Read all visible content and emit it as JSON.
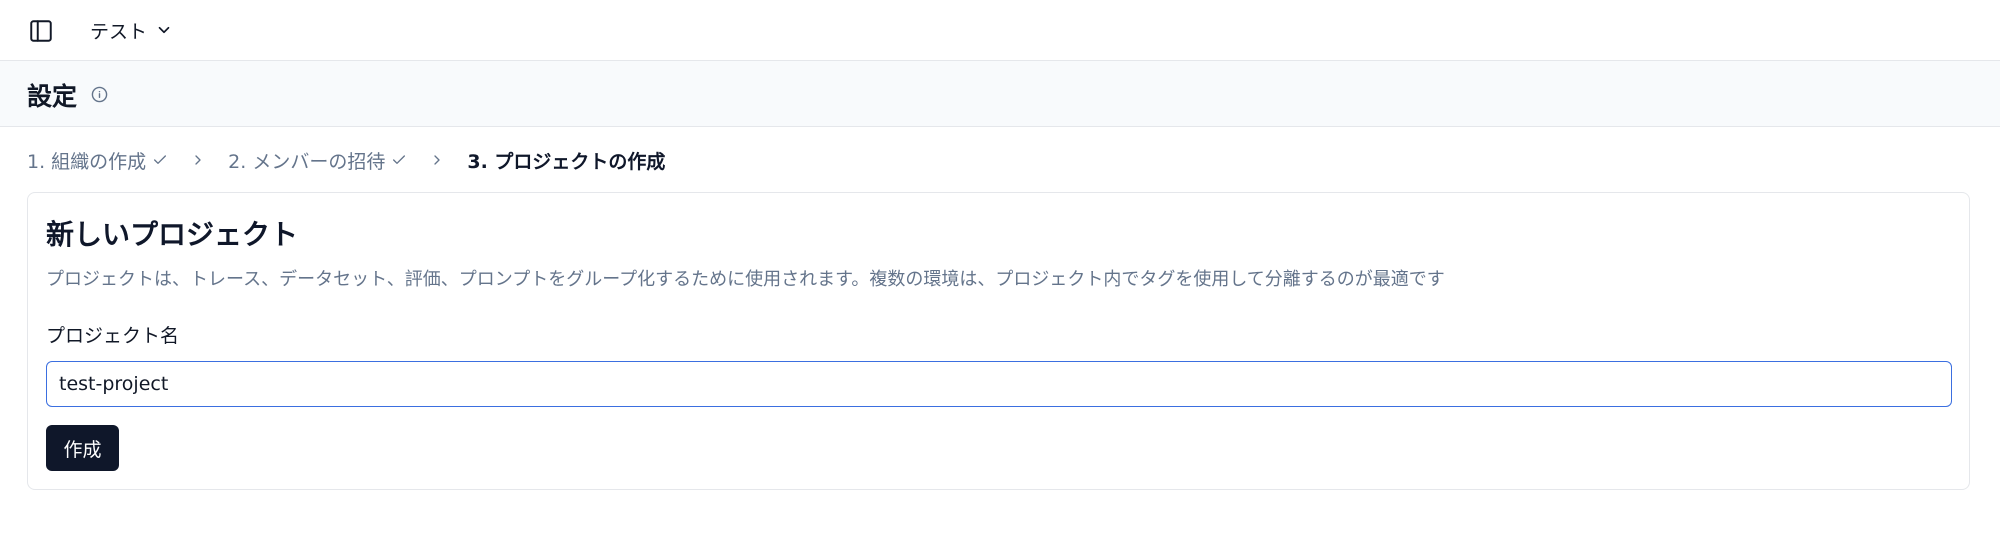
{
  "topbar": {
    "project_name": "テスト"
  },
  "header": {
    "title": "設定"
  },
  "stepper": {
    "steps": [
      {
        "label": "1. 組織の作成",
        "status": "done"
      },
      {
        "label": "2. メンバーの招待",
        "status": "done"
      },
      {
        "label": "3. プロジェクトの作成",
        "status": "active"
      }
    ]
  },
  "card": {
    "title": "新しいプロジェクト",
    "description": "プロジェクトは、トレース、データセット、評価、プロンプトをグループ化するために使用されます。複数の環境は、プロジェクト内でタグを使用して分離するのが最適です",
    "field_label": "プロジェクト名",
    "input_value": "test-project",
    "create_label": "作成"
  },
  "colors": {
    "accent": "#3b6fe0",
    "button_bg": "#0f172a",
    "muted_text": "#64748b"
  },
  "icons": {
    "sidebar_toggle": "sidebar-panel-icon",
    "switcher": "chevron-down-icon",
    "info": "info-circle-icon",
    "step_done": "check-icon",
    "step_separator": "chevron-right-icon"
  }
}
